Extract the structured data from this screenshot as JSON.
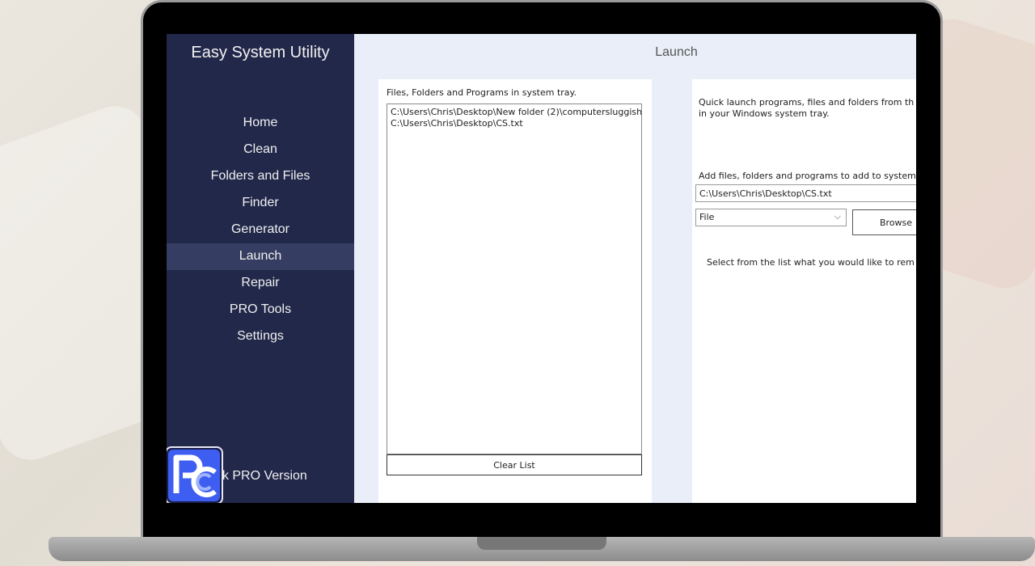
{
  "app": {
    "title": "Easy System Utility",
    "page_title": "Launch"
  },
  "sidebar": {
    "items": [
      {
        "label": "Home"
      },
      {
        "label": "Clean"
      },
      {
        "label": "Folders and Files"
      },
      {
        "label": "Finder"
      },
      {
        "label": "Generator"
      },
      {
        "label": "Launch",
        "active": true
      },
      {
        "label": "Repair"
      },
      {
        "label": "PRO Tools"
      },
      {
        "label": "Settings"
      }
    ],
    "unlock_label": "ock PRO Version"
  },
  "left_panel": {
    "label": "Files, Folders and Programs in system tray.",
    "items": [
      "C:\\Users\\Chris\\Desktop\\New folder (2)\\computersluggish",
      "C:\\Users\\Chris\\Desktop\\CS.txt"
    ],
    "clear_label": "Clear List"
  },
  "right_panel": {
    "description_line1": "Quick launch programs, files and folders from th",
    "description_line2": "in your Windows system tray.",
    "add_label": "Add files, folders and programs to add to system",
    "path_value": "C:\\Users\\Chris\\Desktop\\CS.txt",
    "type_selected": "File",
    "browse_label": "Browse",
    "remove_label": "Select from the list what you would like to rem"
  },
  "colors": {
    "sidebar_bg": "#22284a",
    "sidebar_active": "#353d62",
    "content_bg": "#e9eef8"
  }
}
